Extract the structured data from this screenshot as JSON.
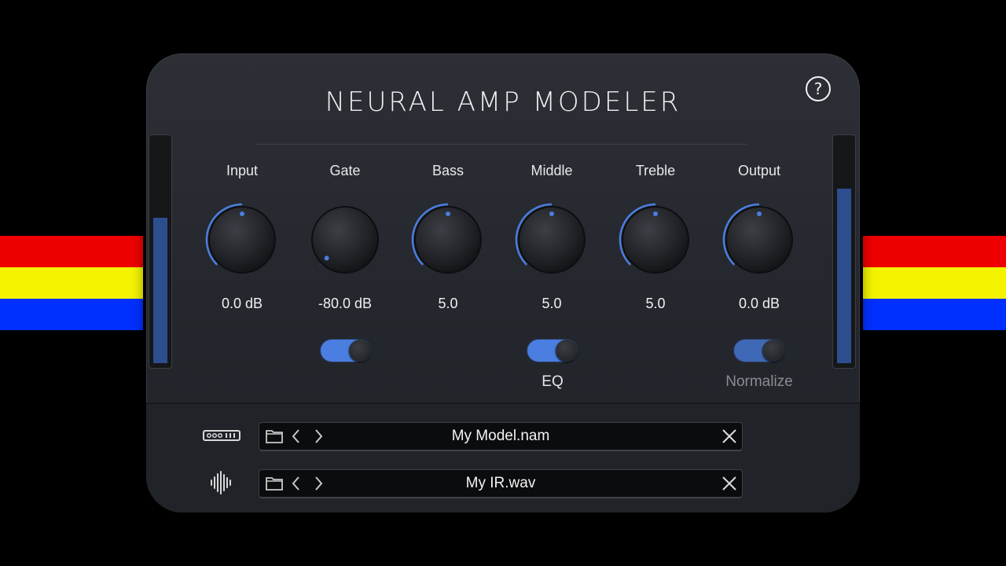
{
  "title": "NEURAL AMP MODELER",
  "help_icon": "?",
  "colors": {
    "accent": "#4a7ee0",
    "stripe_red": "#ee0000",
    "stripe_yellow": "#f3f300",
    "stripe_blue": "#0030ff",
    "panel": "#26292f"
  },
  "knobs": [
    {
      "label": "Input",
      "value": "0.0 dB",
      "level": 0.5
    },
    {
      "label": "Gate",
      "value": "-80.0 dB",
      "level": 0.0
    },
    {
      "label": "Bass",
      "value": "5.0",
      "level": 0.5
    },
    {
      "label": "Middle",
      "value": "5.0",
      "level": 0.5
    },
    {
      "label": "Treble",
      "value": "5.0",
      "level": 0.5
    },
    {
      "label": "Output",
      "value": "0.0 dB",
      "level": 0.5
    }
  ],
  "toggles": {
    "gate": {
      "label": "",
      "on": true
    },
    "eq": {
      "label": "EQ",
      "on": true
    },
    "normalize": {
      "label": "Normalize",
      "on": true
    }
  },
  "meters": {
    "input_level": 0.65,
    "output_level": 0.78
  },
  "model": {
    "icon": "amp-model-icon",
    "filename": "My Model.nam"
  },
  "ir": {
    "icon": "waveform-icon",
    "filename": "My IR.wav"
  }
}
